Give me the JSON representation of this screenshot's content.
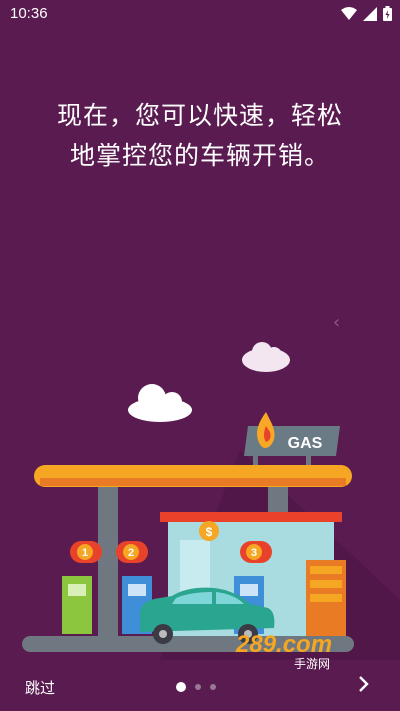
{
  "status": {
    "time": "10:36",
    "icons": [
      "wifi-icon",
      "signal-icon",
      "battery-icon"
    ]
  },
  "headline": {
    "line1": "现在，您可以快速，轻松",
    "line2": "地掌控您的车辆开销。"
  },
  "illustration": {
    "sign_text": "GAS",
    "pump_numbers": [
      "1",
      "2",
      "3"
    ],
    "coin_symbol": "$"
  },
  "navigation": {
    "skip_label": "跳过",
    "next_icon": "chevron-right-icon",
    "pages_total": 3,
    "current_page": 1
  },
  "watermark": {
    "text": "289.com",
    "subtext": "手游网"
  },
  "colors": {
    "background": "#5a1b50",
    "canopy": "#f5a623",
    "car": "#2aa58f"
  }
}
